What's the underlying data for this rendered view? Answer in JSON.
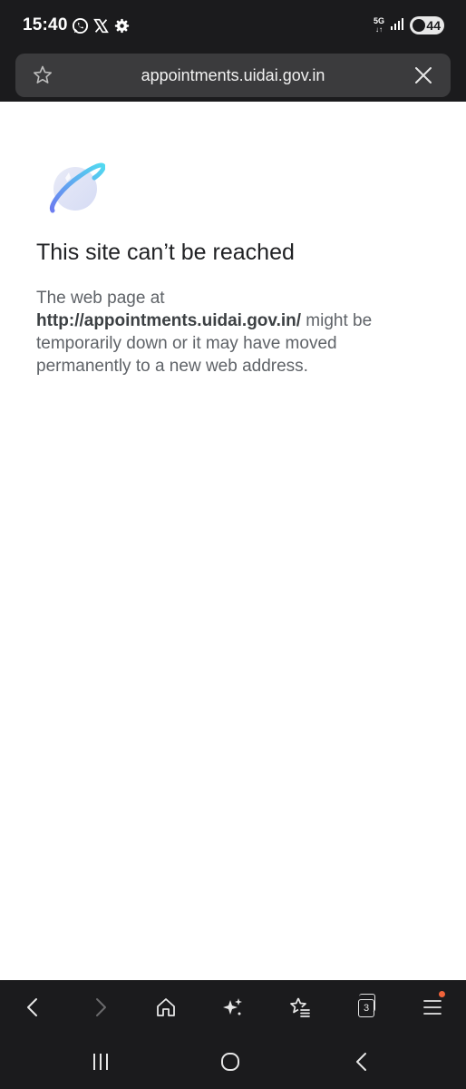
{
  "status_bar": {
    "time": "15:40",
    "network": "5G",
    "battery": "44",
    "icons": [
      "whatsapp-icon",
      "x-icon",
      "settings-icon",
      "signal-icon",
      "battery-icon"
    ]
  },
  "url_bar": {
    "url": "appointments.uidai.gov.in"
  },
  "error_page": {
    "title": "This site can’t be reached",
    "body_prefix": "The web page at",
    "url": "http://appointments.uidai.gov.in/",
    "body_suffix": " might be temporarily down or it may have moved permanently to a new web address."
  },
  "toolbar": {
    "tab_count": "3",
    "items": [
      "back-icon",
      "forward-icon",
      "home-icon",
      "ai-sparkle-icon",
      "bookmarks-icon",
      "tabs-icon",
      "menu-icon"
    ]
  },
  "nav_bar": {
    "items": [
      "recents-icon",
      "home-icon",
      "back-icon"
    ]
  },
  "colors": {
    "chrome_bg": "#1b1b1d",
    "url_field_bg": "#3b3b3d",
    "page_bg": "#ffffff",
    "notification_dot": "#f0633a"
  }
}
